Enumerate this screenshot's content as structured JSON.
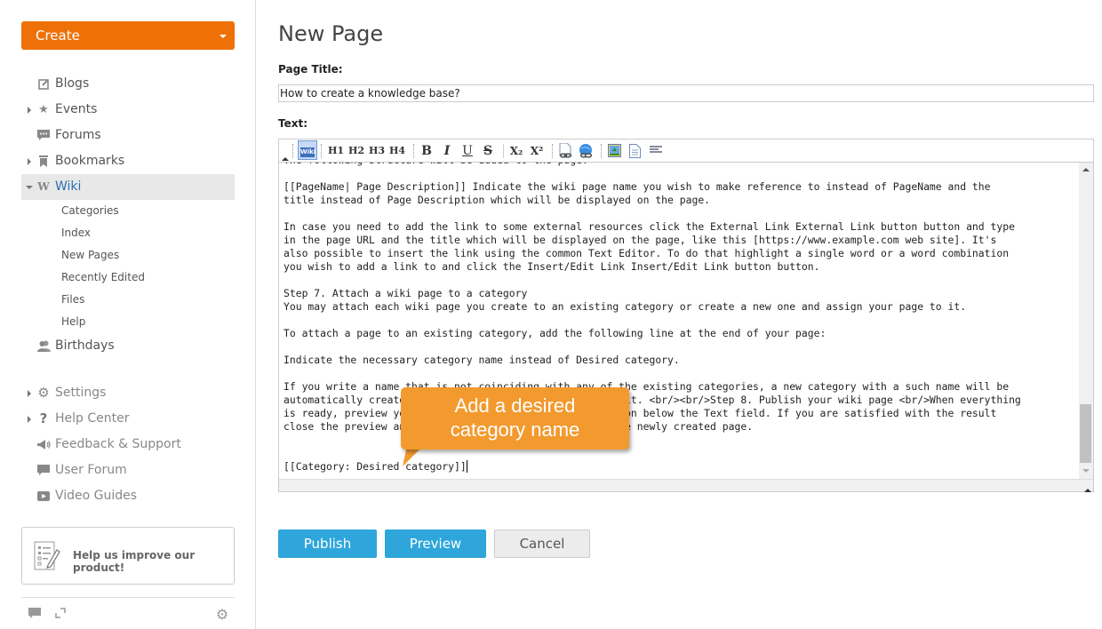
{
  "sidebar": {
    "create_label": "Create",
    "nav": [
      {
        "label": "Blogs",
        "icon": "edit-icon",
        "glyph": "✎",
        "arrow": "none"
      },
      {
        "label": "Events",
        "icon": "star-icon",
        "glyph": "★",
        "arrow": "right"
      },
      {
        "label": "Forums",
        "icon": "chat-bubble-icon",
        "glyph": "▪",
        "arrow": "none"
      },
      {
        "label": "Bookmarks",
        "icon": "bookmark-icon",
        "glyph": "▮",
        "arrow": "right"
      },
      {
        "label": "Wiki",
        "icon": "wiki-w-icon",
        "glyph": "W",
        "arrow": "down",
        "active": true
      }
    ],
    "wiki_sub": [
      "Categories",
      "Index",
      "New Pages",
      "Recently Edited",
      "Files",
      "Help"
    ],
    "after": [
      {
        "label": "Birthdays",
        "icon": "users-icon",
        "glyph": "👥",
        "arrow": "none"
      }
    ],
    "secondary": [
      {
        "label": "Settings",
        "icon": "gear-icon",
        "glyph": "⚙",
        "arrow": "right"
      },
      {
        "label": "Help Center",
        "icon": "question-icon",
        "glyph": "?",
        "arrow": "right"
      },
      {
        "label": "Feedback & Support",
        "icon": "megaphone-icon",
        "glyph": "📢",
        "arrow": "none"
      },
      {
        "label": "User Forum",
        "icon": "comment-icon",
        "glyph": "▪",
        "arrow": "none"
      },
      {
        "label": "Video Guides",
        "icon": "video-play-icon",
        "glyph": "▶",
        "arrow": "none"
      }
    ],
    "feedback_text": "Help us improve our product!"
  },
  "main": {
    "title": "New Page",
    "page_title_label": "Page Title:",
    "page_title_value": "How to create a knowledge base?",
    "text_label": "Text:",
    "toolbar": {
      "wiki": "Wiki",
      "h1": "H1",
      "h2": "H2",
      "h3": "H3",
      "h4": "H4",
      "bold": "B",
      "italic": "I",
      "underline": "U",
      "strike": "S",
      "sub": "X₂",
      "sup": "X²"
    },
    "editor_lines": [
      "The following structure will be added to the page:",
      "",
      "[[PageName| Page Description]] Indicate the wiki page name you wish to make reference to instead of PageName and the",
      "title instead of Page Description which will be displayed on the page.",
      "",
      "In case you need to add the link to some external resources click the External Link External Link button button and type",
      "in the page URL and the title which will be displayed on the page, like this [https://www.example.com web site]. It's",
      "also possible to insert the link using the common Text Editor. To do that highlight a single word or a word combination",
      "you wish to add a link to and click the Insert/Edit Link Insert/Edit Link button button.",
      "",
      "Step 7. Attach a wiki page to a category",
      "You may attach each wiki page you create to an existing category or create a new one and assign your page to it.",
      "",
      "To attach a page to an existing category, add the following line at the end of your page:",
      "",
      "Indicate the necessary category name instead of Desired category.",
      "",
      "If you write a name that is not coinciding with any of the existing categories, a new category with a such name will be",
      "automatically created and your page will be attached to it. <br/><br/>Step 8. Publish your wiki page <br/>When everything",
      "is ready, preview your page by clicking the Preview button below the Text field. If you are satisfied with the result",
      "close the preview and click the Publish button to add the newly created page.",
      "",
      "",
      "[[Category: Desired category]]"
    ],
    "scroll_position": 0.93,
    "callout_line1": "Add a desired",
    "callout_line2": "category name",
    "buttons": {
      "publish": "Publish",
      "preview": "Preview",
      "cancel": "Cancel"
    }
  },
  "colors": {
    "create": "#ee7108",
    "primary": "#2ea6db",
    "callout": "#f39a2f",
    "active_link": "#2b6eb3"
  }
}
